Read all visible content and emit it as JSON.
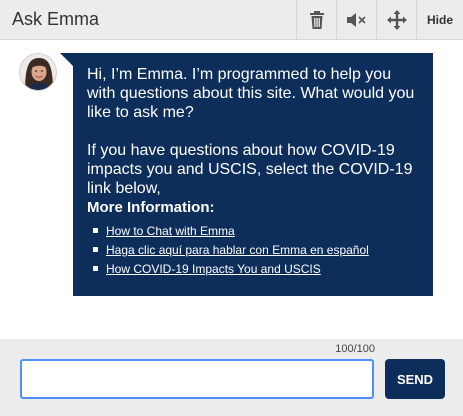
{
  "header": {
    "title": "Ask Emma",
    "buttons": [
      {
        "icon": "trash-icon"
      },
      {
        "icon": "mute-icon"
      },
      {
        "icon": "move-icon"
      },
      {
        "label": "Hide"
      }
    ]
  },
  "message": {
    "para1": "Hi, I’m Emma. I’m programmed to help you with questions about this site. What would you like to ask me?",
    "para2": "If you have questions about how COVID-19 impacts you and USCIS, select the COVID-19 link below,",
    "more_info": "More Information:",
    "links": [
      "How to Chat with Emma",
      "Haga clic aquí para hablar con Emma en español",
      "How COVID-19 Impacts You and USCIS"
    ]
  },
  "footer": {
    "counter": "100/100",
    "input_value": "",
    "send_label": "SEND"
  },
  "colors": {
    "bubble": "#0d2d5b",
    "header": "#ececec",
    "input_focus": "#4d90fe"
  }
}
